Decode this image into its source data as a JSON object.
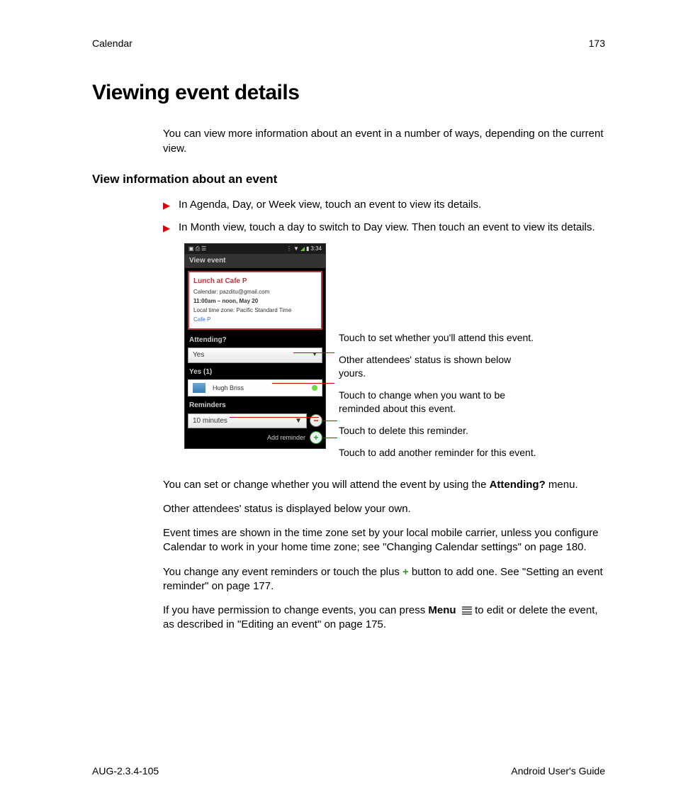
{
  "header": {
    "chapter": "Calendar",
    "page": "173"
  },
  "title": "Viewing event details",
  "intro": "You can view more information about an event in a number of ways, depending on the current view.",
  "subheading": "View information about an event",
  "bullets": [
    "In Agenda, Day, or Week view, touch an event to view its details.",
    "In Month view, touch a day to switch to Day view. Then touch an event to view its details."
  ],
  "phone": {
    "status_time": "3:34",
    "view_event": "View event",
    "event_title": "Lunch at Cafe P",
    "calendar_label": "Calendar:  pazditu@gmail.com",
    "time_line": "11:00am – noon, May 20",
    "tz_line": "Local time zone:  Pacific Standard Time",
    "location": "Cafe P",
    "attending_label": "Attending?",
    "attending_value": "Yes",
    "yes_count": "Yes (1)",
    "attendee_name": "Hugh Briss",
    "reminders_label": "Reminders",
    "reminder_value": "10 minutes",
    "add_reminder": "Add reminder"
  },
  "annotations": {
    "a1": "Touch to set whether you'll attend this event.",
    "a2": "Other attendees' status is shown below yours.",
    "a3": "Touch to change when you want to be reminded about this event.",
    "a4": "Touch to delete this reminder.",
    "a5": "Touch to add another reminder for this event."
  },
  "para1_pre": "You can set or change whether you will attend the event by using the ",
  "para1_bold": "Attending?",
  "para1_post": " menu.",
  "para2": "Other attendees' status is displayed below your own.",
  "para3": "Event times are shown in the time zone set by your local mobile carrier, unless you configure Calendar to work in your home time zone; see \"Changing Calendar settings\" on page 180.",
  "para4_pre": "You change any event reminders or touch the plus ",
  "para4_post": " button to add one. See \"Setting an event reminder\" on page 177.",
  "para5_pre": "If you have permission to change events, you can press ",
  "para5_bold": "Menu",
  "para5_post": " to edit or delete the event, as described in \"Editing an event\" on page 175.",
  "footer": {
    "left": "AUG-2.3.4-105",
    "right": "Android User's Guide"
  }
}
